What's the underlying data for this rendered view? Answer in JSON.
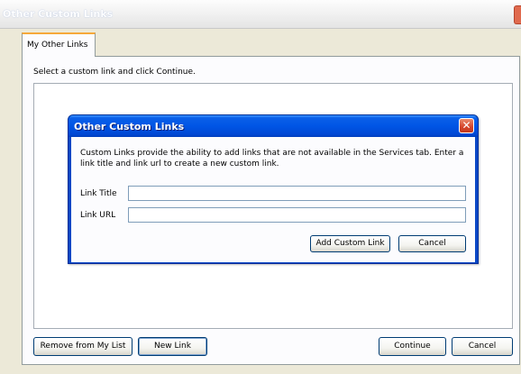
{
  "window": {
    "title": "Other Custom Links"
  },
  "tabs": [
    {
      "label": "My Other Links"
    }
  ],
  "panel": {
    "instruction": "Select a custom link and click Continue."
  },
  "buttons": {
    "remove": "Remove from My List",
    "new_link": "New Link",
    "continue": "Continue",
    "cancel": "Cancel"
  },
  "dialog": {
    "title": "Other Custom Links",
    "close_glyph": "✕",
    "description": "Custom Links provide the ability to add links that are not available in the Services tab. Enter a link title and link url to create a new custom link.",
    "fields": {
      "link_title": {
        "label": "Link Title",
        "value": ""
      },
      "link_url": {
        "label": "Link URL",
        "value": ""
      }
    },
    "buttons": {
      "add": "Add Custom Link",
      "cancel": "Cancel"
    }
  },
  "colors": {
    "dialog_titlebar": "#0055e5",
    "tab_accent": "#f6a93a",
    "close_button": "#d6442a"
  }
}
